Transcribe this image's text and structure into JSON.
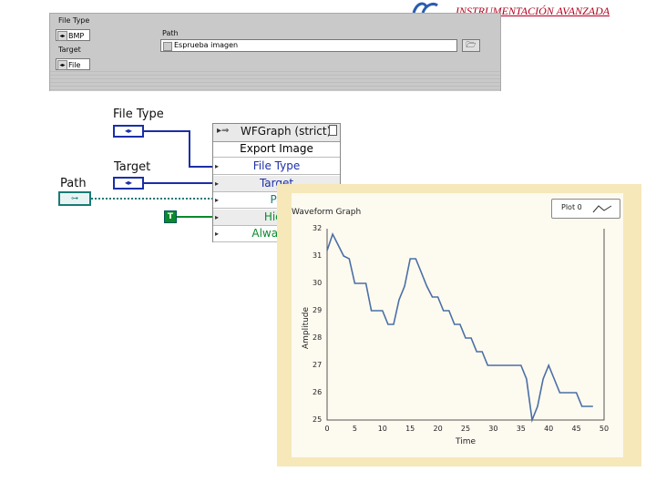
{
  "header": {
    "title": "INSTRUMENTACIÓN AVANZADA"
  },
  "front_panel": {
    "file_type_label": "File Type",
    "file_type_value": "BMP",
    "target_label": "Target",
    "target_value": "File",
    "path_label": "Path",
    "path_value": "Esprueba imagen",
    "path_icon": "path-icon",
    "browse_icon": "folder-icon"
  },
  "block_diagram": {
    "file_type_label": "File Type",
    "target_label": "Target",
    "path_label": "Path",
    "bool_constant": "T",
    "invoke_node": {
      "title": "WFGraph (strict)",
      "method": "Export Image",
      "params": [
        {
          "label": "File Type",
          "color": "#1b2fa8"
        },
        {
          "label": "Target",
          "color": "#1b2fa8"
        },
        {
          "label": "Pa",
          "color": "#1a7a74"
        },
        {
          "label": "Hide",
          "color": "#0a8a2a"
        },
        {
          "label": "Always C",
          "color": "#0a8a2a"
        }
      ]
    }
  },
  "graph": {
    "title": "Waveform Graph",
    "legend_label": "Plot 0",
    "plot_color": "#4a6fa5",
    "background": "#fdfaf0",
    "frame_color": "#f6e8b9"
  },
  "chart_data": {
    "type": "line",
    "title": "Waveform Graph",
    "xlabel": "Time",
    "ylabel": "Amplitude",
    "xlim": [
      0,
      50
    ],
    "ylim": [
      25,
      32
    ],
    "xticks": [
      0,
      5,
      10,
      15,
      20,
      25,
      30,
      35,
      40,
      45,
      50
    ],
    "yticks": [
      25,
      26,
      27,
      28,
      29,
      30,
      31,
      32
    ],
    "grid": false,
    "legend": "top-right",
    "series": [
      {
        "name": "Plot 0",
        "x": [
          0,
          1,
          2,
          3,
          4,
          5,
          6,
          7,
          8,
          9,
          10,
          11,
          12,
          13,
          14,
          15,
          16,
          17,
          18,
          19,
          20,
          21,
          22,
          23,
          24,
          25,
          26,
          27,
          28,
          29,
          30,
          31,
          32,
          33,
          34,
          35,
          36,
          37,
          38,
          39,
          40,
          41,
          42,
          43,
          44,
          45,
          46,
          47,
          48
        ],
        "y": [
          31.2,
          31.8,
          31.4,
          31.0,
          30.9,
          30.0,
          30.0,
          30.0,
          29.0,
          29.0,
          29.0,
          28.5,
          28.5,
          29.4,
          29.9,
          30.9,
          30.9,
          30.4,
          29.9,
          29.5,
          29.5,
          29.0,
          29.0,
          28.5,
          28.5,
          28.0,
          28.0,
          27.5,
          27.5,
          27.0,
          27.0,
          27.0,
          27.0,
          27.0,
          27.0,
          27.0,
          26.5,
          25.0,
          25.5,
          26.5,
          27.0,
          26.5,
          26.0,
          26.0,
          26.0,
          26.0,
          25.5,
          25.5,
          25.5
        ]
      }
    ]
  }
}
